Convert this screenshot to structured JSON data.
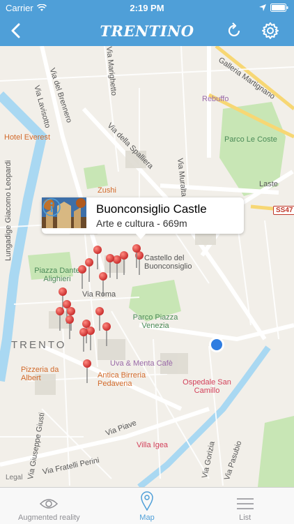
{
  "status_bar": {
    "carrier": "Carrier",
    "time": "2:19 PM"
  },
  "navbar": {
    "logo_text": "TRENTINO"
  },
  "map": {
    "legal": "Legal",
    "road_badge": "SS47",
    "labels": {
      "galleria": "Galleria Martignano",
      "via_brennero": "Via del Brennero",
      "via_spalliera": "Via della Spalliera",
      "hotel_everest": "Hotel Everest",
      "rebuffo": "Rebuffo",
      "parco_le_coste": "Parco Le Coste",
      "zushi": "Zushi",
      "lungadige": "Lungadige Giacomo Leopardi",
      "piazza_dante": "Piazza Dante Alighieri",
      "castello": "Castello del Buonconsiglio",
      "parco_venezia": "Parco Piazza Venezia",
      "trento": "TRENTO",
      "via_roma": "Via Roma",
      "uva_menta": "Uva & Menta Cafè",
      "birreria": "Antica Birreria Pedavena",
      "pizzeria": "Pizzeria da Albert",
      "ospedale": "Ospedale San Camillo",
      "via_piave": "Via Piave",
      "villa_igea": "Villa Igea",
      "via_giusti": "Via Giuseppe Giusti",
      "via_perini": "Via Fratelli Perini",
      "via_pasubio": "Via Pasubio",
      "via_gorizia": "Via Gorizia",
      "laste": "Laste",
      "via_marighetto": "Via Marighetto",
      "via_muralta": "Via Muralta",
      "via_lavisotto": "Via Lavisotto"
    }
  },
  "callout": {
    "title": "Buonconsiglio Castle",
    "subtitle": "Arte e cultura - 669m"
  },
  "tabs": [
    {
      "label": "Augmented reality",
      "icon": "eye-icon"
    },
    {
      "label": "Map",
      "icon": "location-pin-icon"
    },
    {
      "label": "List",
      "icon": "list-icon"
    }
  ],
  "colors": {
    "primary": "#4f9fd8",
    "pin": "#e53935",
    "park": "#c8e6b5",
    "water": "#a9d8f2"
  }
}
